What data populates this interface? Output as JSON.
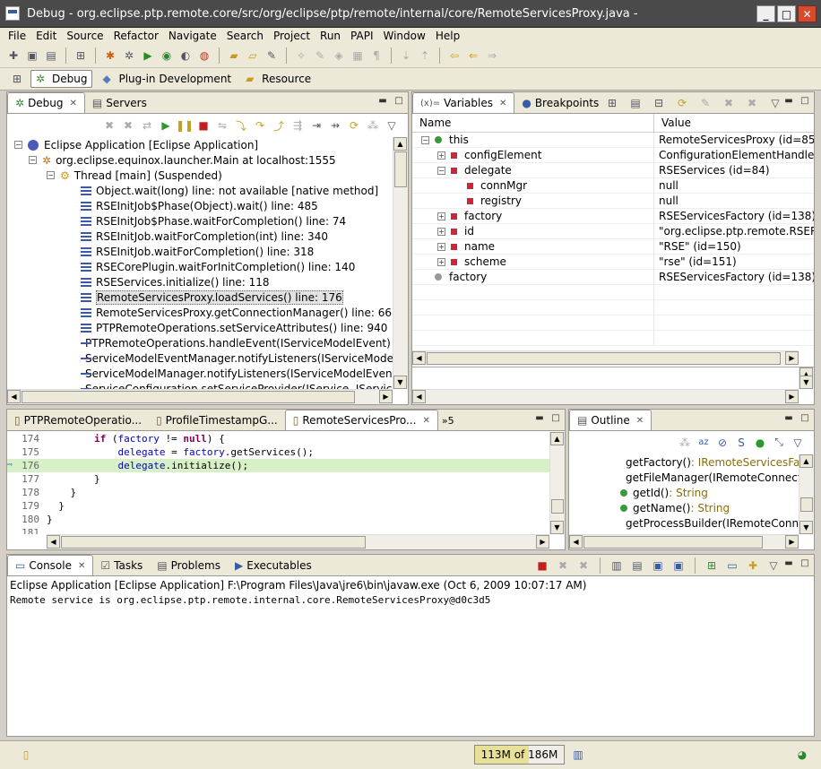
{
  "window": {
    "title": "Debug - org.eclipse.ptp.remote.core/src/org/eclipse/ptp/remote/internal/core/RemoteServicesProxy.java -"
  },
  "menu": [
    "File",
    "Edit",
    "Source",
    "Refactor",
    "Navigate",
    "Search",
    "Project",
    "Run",
    "PAPI",
    "Window",
    "Help"
  ],
  "perspectives": [
    {
      "label": "Debug",
      "active": true
    },
    {
      "label": "Plug-in Development",
      "active": false
    },
    {
      "label": "Resource",
      "active": false
    }
  ],
  "debug_view": {
    "tabs": [
      "Debug",
      "Servers"
    ],
    "launch": "Eclipse Application [Eclipse Application]",
    "target": "org.eclipse.equinox.launcher.Main at localhost:1555",
    "thread": "Thread [main] (Suspended)",
    "frames": [
      "Object.wait(long) line: not available [native method]",
      "RSEInitJob$Phase(Object).wait() line: 485",
      "RSEInitJob$Phase.waitForCompletion() line: 74",
      "RSEInitJob.waitForCompletion(int) line: 340",
      "RSEInitJob.waitForCompletion() line: 318",
      "RSECorePlugin.waitForInitCompletion() line: 140",
      "RSEServices.initialize() line: 118",
      "RemoteServicesProxy.loadServices() line: 176",
      "RemoteServicesProxy.getConnectionManager() line: 66",
      "PTPRemoteOperations.setServiceAttributes() line: 940",
      "PTPRemoteOperations.handleEvent(IServiceModelEvent) line: 576",
      "ServiceModelEventManager.notifyListeners(IServiceModelEvent) line",
      "ServiceModelManager.notifyListeners(IServiceModelEvent) line: 526",
      "ServiceConfiguration.setServiceProvider(IService, IServiceProvider) li"
    ],
    "selected_frame": 7
  },
  "variables_view": {
    "tabs": [
      "Variables",
      "Breakpoints"
    ],
    "columns": [
      "Name",
      "Value"
    ],
    "rows": [
      {
        "indent": 0,
        "exp": "-",
        "icon": "green",
        "name": "this",
        "value": "RemoteServicesProxy  (id=85)"
      },
      {
        "indent": 1,
        "exp": "+",
        "icon": "red",
        "name": "configElement",
        "value": "ConfigurationElementHandle  (id=14"
      },
      {
        "indent": 1,
        "exp": "-",
        "icon": "red",
        "name": "delegate",
        "value": "RSEServices  (id=84)"
      },
      {
        "indent": 2,
        "exp": "",
        "icon": "red",
        "name": "connMgr",
        "value": "null"
      },
      {
        "indent": 2,
        "exp": "",
        "icon": "red",
        "name": "registry",
        "value": "null"
      },
      {
        "indent": 1,
        "exp": "+",
        "icon": "red",
        "name": "factory",
        "value": "RSEServicesFactory  (id=138)"
      },
      {
        "indent": 1,
        "exp": "+",
        "icon": "red",
        "name": "id",
        "value": "\"org.eclipse.ptp.remote.RSERemote"
      },
      {
        "indent": 1,
        "exp": "+",
        "icon": "red",
        "name": "name",
        "value": "\"RSE\" (id=150)"
      },
      {
        "indent": 1,
        "exp": "+",
        "icon": "red",
        "name": "scheme",
        "value": "\"rse\" (id=151)"
      },
      {
        "indent": 0,
        "exp": "",
        "icon": "gray",
        "name": "factory",
        "value": "RSEServicesFactory  (id=138)"
      }
    ]
  },
  "editor": {
    "tabs": [
      "PTPRemoteOperatio...",
      "ProfileTimestampG...",
      "RemoteServicesPro..."
    ],
    "overflow": "»5",
    "lines": [
      {
        "n": "174",
        "code": "        if (factory != null) {"
      },
      {
        "n": "175",
        "code": "            delegate = factory.getServices();"
      },
      {
        "n": "176",
        "code": "            delegate.initialize();",
        "current": true
      },
      {
        "n": "177",
        "code": "        }"
      },
      {
        "n": "178",
        "code": "    }"
      },
      {
        "n": "179",
        "code": "  }"
      },
      {
        "n": "180",
        "code": "}"
      },
      {
        "n": "181",
        "code": ""
      }
    ]
  },
  "outline": {
    "tab": "Outline",
    "items": [
      {
        "name": "getFactory()",
        "type": " : IRemoteServicesFacto"
      },
      {
        "name": "getFileManager(IRemoteConnection)",
        "type": ""
      },
      {
        "name": "getId()",
        "type": " : String"
      },
      {
        "name": "getName()",
        "type": " : String"
      },
      {
        "name": "getProcessBuilder(IRemoteConnecti",
        "type": ""
      }
    ]
  },
  "console": {
    "tabs": [
      "Console",
      "Tasks",
      "Problems",
      "Executables"
    ],
    "header": "Eclipse Application [Eclipse Application] F:\\Program Files\\Java\\jre6\\bin\\javaw.exe (Oct 6, 2009 10:07:17 AM)",
    "output": "Remote service is org.eclipse.ptp.remote.internal.core.RemoteServicesProxy@d0c3d5"
  },
  "status": {
    "heap_label": "113M of 186M",
    "heap_used_fraction": 0.61
  }
}
